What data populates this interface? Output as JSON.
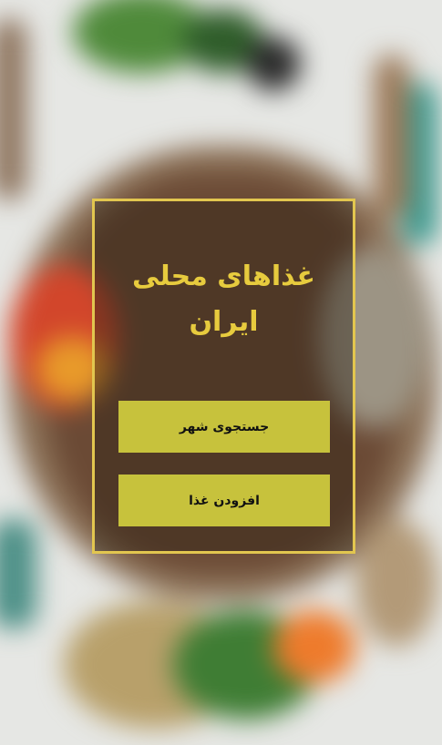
{
  "card": {
    "title_line1": "غذاهای محلی",
    "title_line2": "ایران"
  },
  "buttons": {
    "search_city_label": "جستجوی شهر",
    "add_food_label": "افزودن غذا"
  },
  "colors": {
    "accent_gold": "#e2c64f",
    "title_gold": "#e7cb3e",
    "button_olive": "#c7c23c",
    "button_text": "#111111"
  }
}
